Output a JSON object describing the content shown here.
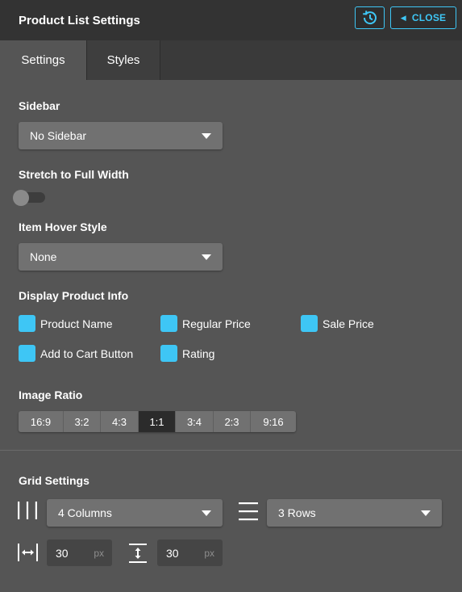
{
  "header": {
    "title": "Product List Settings",
    "close_label": "CLOSE",
    "accent": "#3ec6f5"
  },
  "tabs": [
    {
      "label": "Settings",
      "active": true
    },
    {
      "label": "Styles",
      "active": false
    }
  ],
  "sidebar": {
    "label": "Sidebar",
    "value": "No Sidebar"
  },
  "stretch": {
    "label": "Stretch to Full Width",
    "enabled": false
  },
  "hover": {
    "label": "Item Hover Style",
    "value": "None"
  },
  "product_info": {
    "label": "Display Product Info",
    "options": [
      {
        "label": "Product Name",
        "checked": true
      },
      {
        "label": "Regular Price",
        "checked": true
      },
      {
        "label": "Sale Price",
        "checked": true
      },
      {
        "label": "Add to Cart Button",
        "checked": true
      },
      {
        "label": "Rating",
        "checked": true
      }
    ]
  },
  "image_ratio": {
    "label": "Image Ratio",
    "options": [
      "16:9",
      "3:2",
      "4:3",
      "1:1",
      "3:4",
      "2:3",
      "9:16"
    ],
    "selected": "1:1"
  },
  "grid": {
    "label": "Grid Settings",
    "columns": "4 Columns",
    "rows": "3 Rows",
    "column_gap": "30",
    "row_gap": "30",
    "unit": "px"
  },
  "icons": {
    "history": "history-icon",
    "close_caret": "caret-left-icon",
    "columns": "columns-icon",
    "rows": "rows-icon",
    "column_gap": "horizontal-spacing-icon",
    "row_gap": "vertical-spacing-icon"
  }
}
